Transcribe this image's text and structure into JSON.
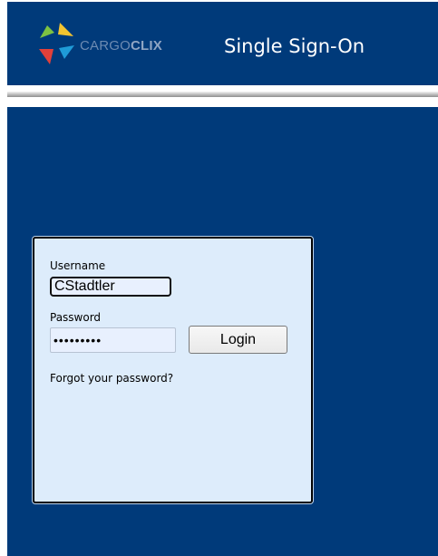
{
  "header": {
    "logo_text_light": "CARGO",
    "logo_text_bold": "CLIX",
    "title": "Single Sign-On"
  },
  "login": {
    "username_label": "Username",
    "username_value": "CStadtler",
    "password_label": "Password",
    "password_value": "•••••••••",
    "login_button_label": "Login",
    "forgot_password_link": "Forgot your password?"
  },
  "colors": {
    "header_background": "#003a7a",
    "page_background": "#003a7a",
    "panel_background": "#ddecfb",
    "logo_green": "#7dc242",
    "logo_yellow": "#f4c430",
    "logo_red": "#e2403a",
    "logo_blue": "#1f9bd8"
  },
  "icons": {
    "logo": "cargoclix-pinwheel-logo"
  }
}
